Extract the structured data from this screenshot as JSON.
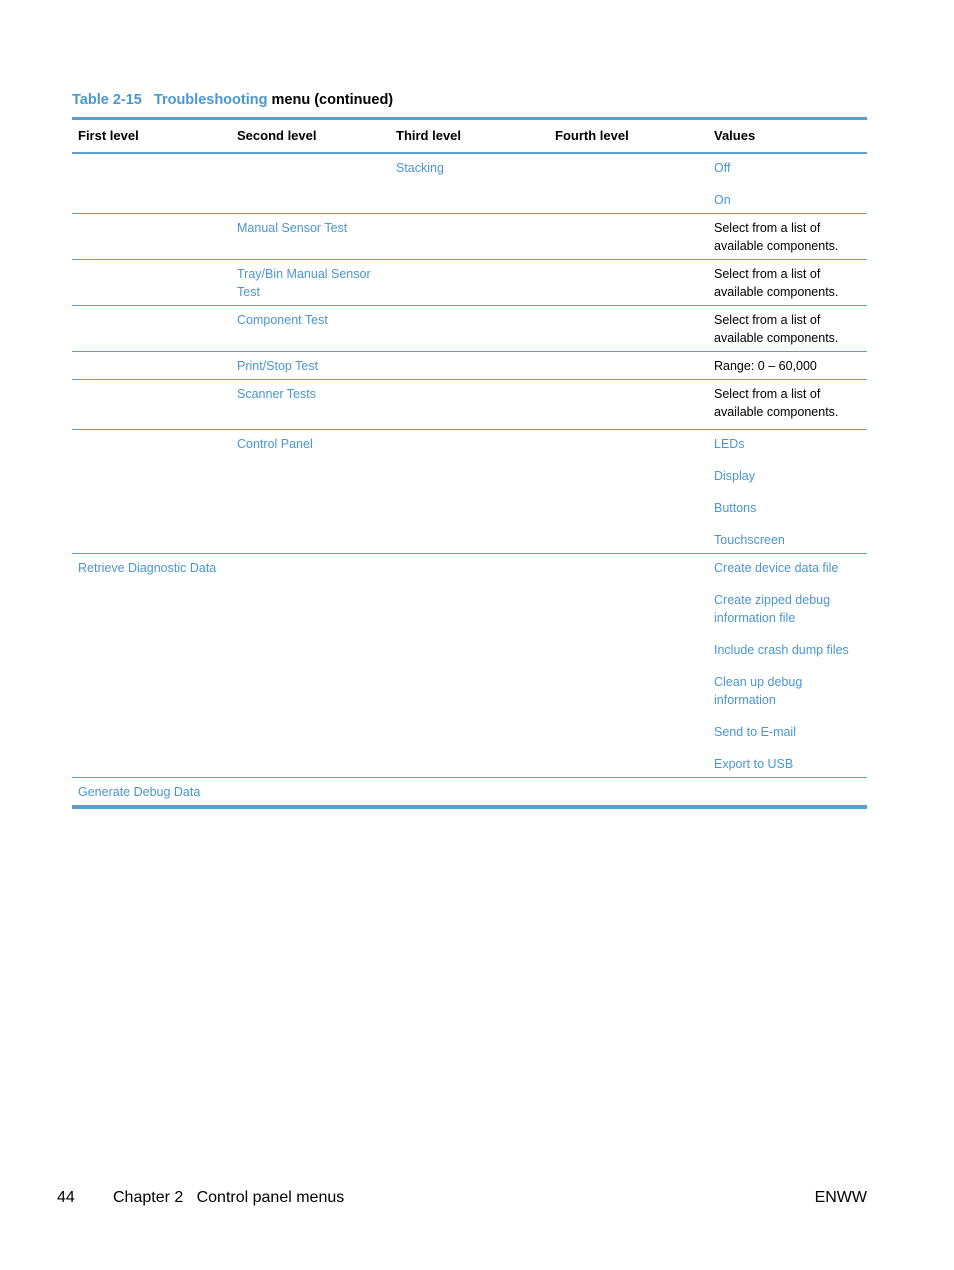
{
  "caption": {
    "number": "Table 2-15",
    "menu_name": "Troubleshooting",
    "suffix": "menu (continued)"
  },
  "table": {
    "headers": [
      "First level",
      "Second level",
      "Third level",
      "Fourth level",
      "Values"
    ],
    "rows": [
      {
        "first": "",
        "second": "",
        "third": "Stacking",
        "fourth": "",
        "values": [
          "Off",
          "On"
        ],
        "values_link": true
      },
      {
        "first": "",
        "second": "Manual Sensor Test",
        "third": "",
        "fourth": "",
        "values": [
          "Select from a list of available components."
        ],
        "values_link": false
      },
      {
        "first": "",
        "second": "Tray/Bin Manual Sensor Test",
        "third": "",
        "fourth": "",
        "values": [
          "Select from a list of available components."
        ],
        "values_link": false
      },
      {
        "first": "",
        "second": "Component Test",
        "third": "",
        "fourth": "",
        "values": [
          "Select from a list of available components."
        ],
        "values_link": false
      },
      {
        "first": "",
        "second": "Print/Stop Test",
        "third": "",
        "fourth": "",
        "values": [
          "Range: 0 – 60,000"
        ],
        "values_link": false
      },
      {
        "first": "",
        "second": "Scanner Tests",
        "third": "",
        "fourth": "",
        "values": [
          "Select from a list of available components."
        ],
        "values_link": false
      },
      {
        "first": "",
        "second": "Control Panel",
        "third": "",
        "fourth": "",
        "values": [
          "LEDs",
          "Display",
          "Buttons",
          "Touchscreen"
        ],
        "values_link": true
      },
      {
        "first": "Retrieve Diagnostic Data",
        "second": "",
        "third": "",
        "fourth": "",
        "values": [
          "Create device data file",
          "Create zipped debug information file",
          "Include crash dump files",
          "Clean up debug information",
          "Send to E-mail",
          "Export to USB"
        ],
        "values_link": true
      },
      {
        "first": "Generate Debug Data",
        "second": "",
        "third": "",
        "fourth": "",
        "values": [],
        "values_link": true
      }
    ]
  },
  "footer": {
    "page_number": "44",
    "chapter": "Chapter 2   Control panel menus",
    "locale": "ENWW"
  },
  "colors": {
    "accent": "#4a97cf",
    "rule": "#5a9ed3"
  }
}
